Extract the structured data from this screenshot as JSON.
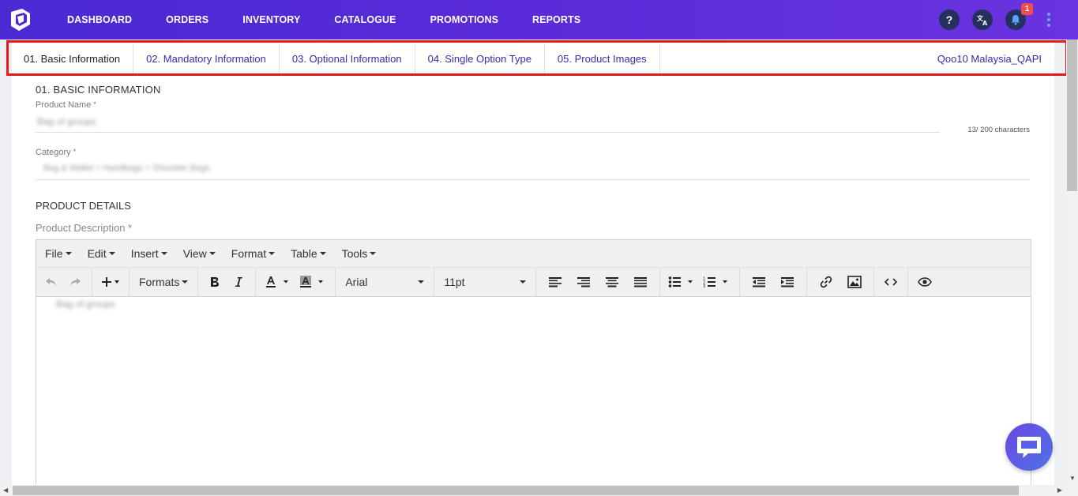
{
  "nav": {
    "items": [
      "DASHBOARD",
      "ORDERS",
      "INVENTORY",
      "CATALOGUE",
      "PROMOTIONS",
      "REPORTS"
    ],
    "help_glyph": "?",
    "notification_count": "1",
    "icons": [
      "logo-icon",
      "help-icon",
      "translate-icon",
      "bell-icon",
      "kebab-menu-icon"
    ]
  },
  "tabs": {
    "items": [
      "01. Basic Information",
      "02. Mandatory Information",
      "03. Optional Information",
      "04. Single Option Type",
      "05. Product Images"
    ],
    "active_index": 0,
    "account": "Qoo10 Malaysia_QAPI"
  },
  "basic": {
    "title": "01. BASIC INFORMATION",
    "product_name_label": "Product Name",
    "product_name_value": "Bag of groups",
    "char_count": "13/ 200 characters",
    "category_label": "Category",
    "category_value": "Bag & Wallet > Handbags > Shoulder Bags",
    "required_mark": "*"
  },
  "details": {
    "title": "PRODUCT DETAILS",
    "description_label": "Product Description",
    "required_mark": "*"
  },
  "editor": {
    "menus": [
      "File",
      "Edit",
      "Insert",
      "View",
      "Format",
      "Table",
      "Tools"
    ],
    "formats_label": "Formats",
    "font_family": "Arial",
    "font_size": "11pt",
    "content": "Bag of groups"
  },
  "colors": {
    "nav_gradient_start": "#4a2ad3",
    "nav_gradient_end": "#6a33e0",
    "tab_link": "#3c2aa6",
    "highlight_frame": "#e21c1c",
    "badge": "#f04d4d"
  }
}
